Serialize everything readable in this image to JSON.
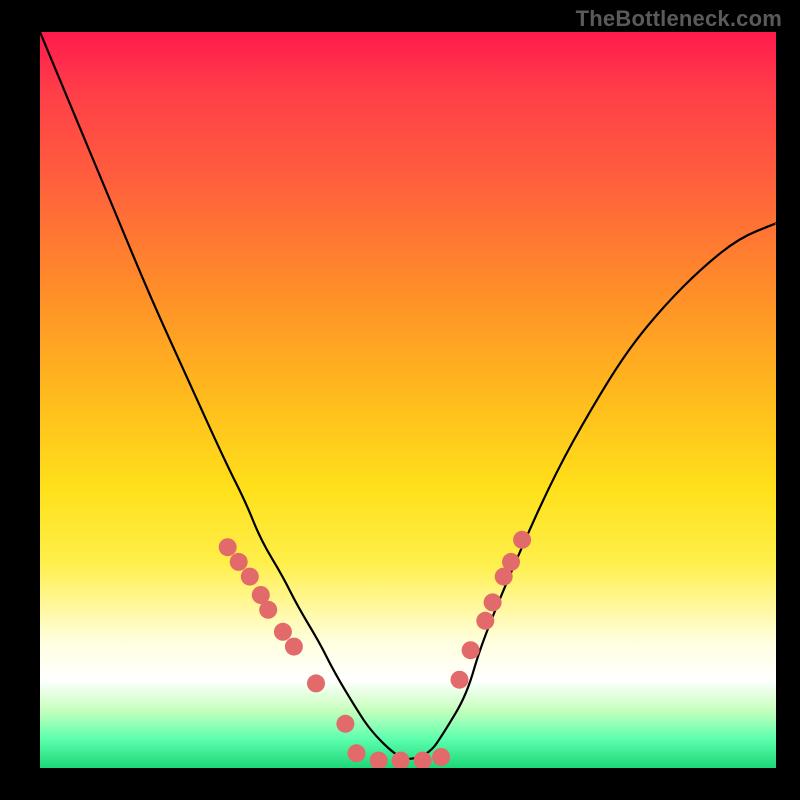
{
  "attribution": "TheBottleneck.com",
  "colors": {
    "curve_stroke": "#000000",
    "dot_fill": "#e26a6a",
    "background_border": "#000000"
  },
  "chart_data": {
    "type": "line",
    "title": "",
    "xlabel": "",
    "ylabel": "",
    "xlim": [
      0,
      1
    ],
    "ylim": [
      0,
      1
    ],
    "x": [
      0.0,
      0.05,
      0.1,
      0.15,
      0.2,
      0.25,
      0.28,
      0.3,
      0.33,
      0.35,
      0.38,
      0.4,
      0.43,
      0.45,
      0.48,
      0.5,
      0.53,
      0.55,
      0.58,
      0.6,
      0.65,
      0.7,
      0.75,
      0.8,
      0.85,
      0.9,
      0.95,
      1.0
    ],
    "values": [
      1.0,
      0.88,
      0.76,
      0.64,
      0.53,
      0.42,
      0.36,
      0.31,
      0.26,
      0.22,
      0.17,
      0.13,
      0.08,
      0.05,
      0.02,
      0.01,
      0.02,
      0.05,
      0.1,
      0.17,
      0.29,
      0.4,
      0.49,
      0.57,
      0.63,
      0.68,
      0.72,
      0.74
    ],
    "note": "y=1 is top (max bottleneck), y=0 is bottom (optimal). Curve is a V / check-mark shape with minimum near x≈0.50.",
    "highlight_dots": {
      "left_cluster_x": [
        0.255,
        0.27,
        0.285,
        0.3,
        0.31,
        0.33,
        0.345,
        0.375,
        0.415
      ],
      "left_cluster_y": [
        0.3,
        0.28,
        0.26,
        0.235,
        0.215,
        0.185,
        0.165,
        0.115,
        0.06
      ],
      "floor_cluster_x": [
        0.43,
        0.46,
        0.49,
        0.52,
        0.545
      ],
      "floor_cluster_y": [
        0.02,
        0.01,
        0.01,
        0.01,
        0.015
      ],
      "right_cluster_x": [
        0.57,
        0.585,
        0.605,
        0.615,
        0.63,
        0.64,
        0.655
      ],
      "right_cluster_y": [
        0.12,
        0.16,
        0.2,
        0.225,
        0.26,
        0.28,
        0.31
      ]
    }
  }
}
